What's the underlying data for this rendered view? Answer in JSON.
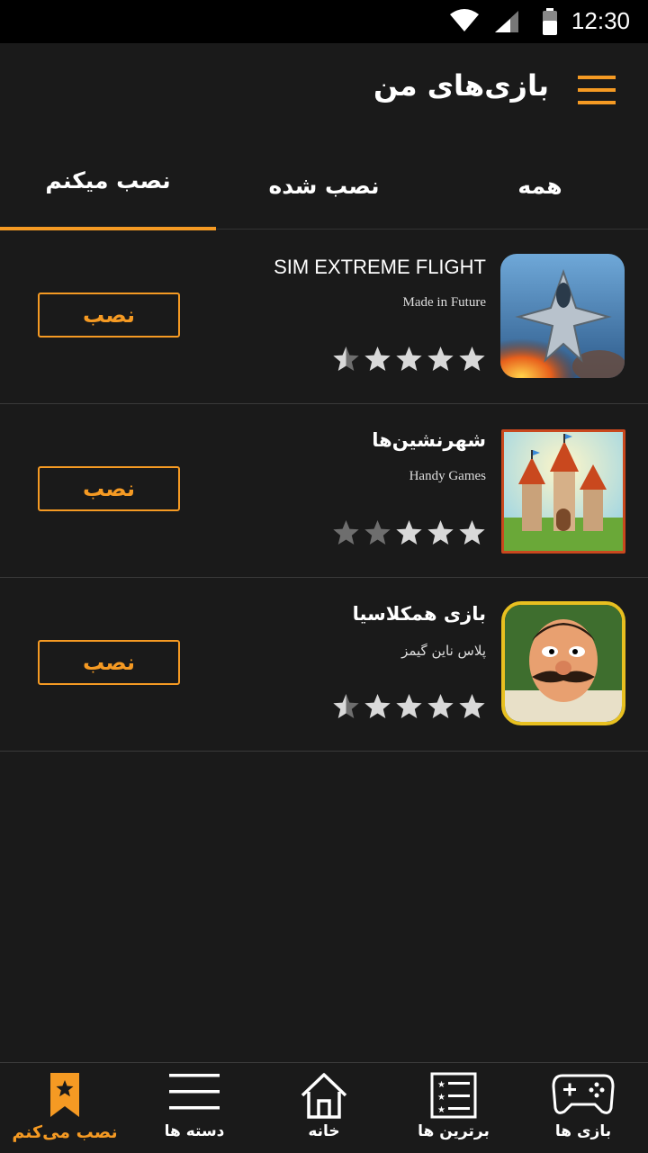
{
  "status_bar": {
    "time": "12:30"
  },
  "header": {
    "title": "بازی‌های من"
  },
  "tabs": [
    {
      "label": "همه"
    },
    {
      "label": "نصب شده"
    },
    {
      "label": "نصب میکنم"
    }
  ],
  "apps": [
    {
      "title": "SIM EXTREME FLIGHT",
      "developer": "Made in Future",
      "rating": 4.5,
      "install_label": "نصب"
    },
    {
      "title": "شهرنشین‌ها",
      "developer": "Handy Games",
      "rating": 3,
      "install_label": "نصب"
    },
    {
      "title": "بازی همکلاسیا",
      "developer": "پلاس ناین گیمز",
      "rating": 4.5,
      "install_label": "نصب"
    }
  ],
  "bottom_nav": [
    {
      "label": "بازی ها",
      "icon": "gamepad-icon"
    },
    {
      "label": "برترین ها",
      "icon": "ranked-list-icon"
    },
    {
      "label": "خانه",
      "icon": "home-icon"
    },
    {
      "label": "دسته ها",
      "icon": "hamburger-list-icon"
    },
    {
      "label": "نصب می‌کنم",
      "icon": "bookmark-star-icon"
    }
  ],
  "colors": {
    "accent": "#f59a23",
    "background": "#1a1a1a",
    "star_full": "#d9d9d9",
    "star_empty": "#6e6e6e"
  }
}
